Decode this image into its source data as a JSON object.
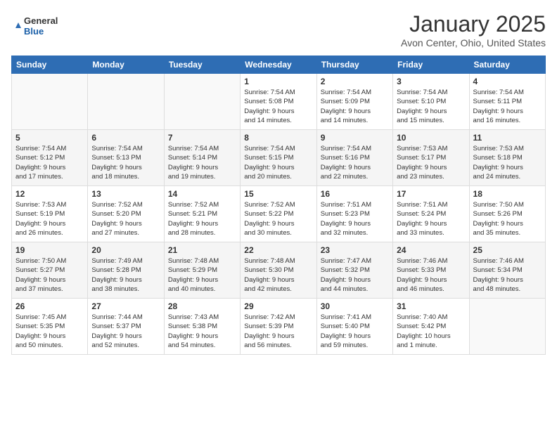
{
  "header": {
    "logo_general": "General",
    "logo_blue": "Blue",
    "month": "January 2025",
    "location": "Avon Center, Ohio, United States"
  },
  "weekdays": [
    "Sunday",
    "Monday",
    "Tuesday",
    "Wednesday",
    "Thursday",
    "Friday",
    "Saturday"
  ],
  "weeks": [
    [
      {
        "day": "",
        "info": ""
      },
      {
        "day": "",
        "info": ""
      },
      {
        "day": "",
        "info": ""
      },
      {
        "day": "1",
        "info": "Sunrise: 7:54 AM\nSunset: 5:08 PM\nDaylight: 9 hours\nand 14 minutes."
      },
      {
        "day": "2",
        "info": "Sunrise: 7:54 AM\nSunset: 5:09 PM\nDaylight: 9 hours\nand 14 minutes."
      },
      {
        "day": "3",
        "info": "Sunrise: 7:54 AM\nSunset: 5:10 PM\nDaylight: 9 hours\nand 15 minutes."
      },
      {
        "day": "4",
        "info": "Sunrise: 7:54 AM\nSunset: 5:11 PM\nDaylight: 9 hours\nand 16 minutes."
      }
    ],
    [
      {
        "day": "5",
        "info": "Sunrise: 7:54 AM\nSunset: 5:12 PM\nDaylight: 9 hours\nand 17 minutes."
      },
      {
        "day": "6",
        "info": "Sunrise: 7:54 AM\nSunset: 5:13 PM\nDaylight: 9 hours\nand 18 minutes."
      },
      {
        "day": "7",
        "info": "Sunrise: 7:54 AM\nSunset: 5:14 PM\nDaylight: 9 hours\nand 19 minutes."
      },
      {
        "day": "8",
        "info": "Sunrise: 7:54 AM\nSunset: 5:15 PM\nDaylight: 9 hours\nand 20 minutes."
      },
      {
        "day": "9",
        "info": "Sunrise: 7:54 AM\nSunset: 5:16 PM\nDaylight: 9 hours\nand 22 minutes."
      },
      {
        "day": "10",
        "info": "Sunrise: 7:53 AM\nSunset: 5:17 PM\nDaylight: 9 hours\nand 23 minutes."
      },
      {
        "day": "11",
        "info": "Sunrise: 7:53 AM\nSunset: 5:18 PM\nDaylight: 9 hours\nand 24 minutes."
      }
    ],
    [
      {
        "day": "12",
        "info": "Sunrise: 7:53 AM\nSunset: 5:19 PM\nDaylight: 9 hours\nand 26 minutes."
      },
      {
        "day": "13",
        "info": "Sunrise: 7:52 AM\nSunset: 5:20 PM\nDaylight: 9 hours\nand 27 minutes."
      },
      {
        "day": "14",
        "info": "Sunrise: 7:52 AM\nSunset: 5:21 PM\nDaylight: 9 hours\nand 28 minutes."
      },
      {
        "day": "15",
        "info": "Sunrise: 7:52 AM\nSunset: 5:22 PM\nDaylight: 9 hours\nand 30 minutes."
      },
      {
        "day": "16",
        "info": "Sunrise: 7:51 AM\nSunset: 5:23 PM\nDaylight: 9 hours\nand 32 minutes."
      },
      {
        "day": "17",
        "info": "Sunrise: 7:51 AM\nSunset: 5:24 PM\nDaylight: 9 hours\nand 33 minutes."
      },
      {
        "day": "18",
        "info": "Sunrise: 7:50 AM\nSunset: 5:26 PM\nDaylight: 9 hours\nand 35 minutes."
      }
    ],
    [
      {
        "day": "19",
        "info": "Sunrise: 7:50 AM\nSunset: 5:27 PM\nDaylight: 9 hours\nand 37 minutes."
      },
      {
        "day": "20",
        "info": "Sunrise: 7:49 AM\nSunset: 5:28 PM\nDaylight: 9 hours\nand 38 minutes."
      },
      {
        "day": "21",
        "info": "Sunrise: 7:48 AM\nSunset: 5:29 PM\nDaylight: 9 hours\nand 40 minutes."
      },
      {
        "day": "22",
        "info": "Sunrise: 7:48 AM\nSunset: 5:30 PM\nDaylight: 9 hours\nand 42 minutes."
      },
      {
        "day": "23",
        "info": "Sunrise: 7:47 AM\nSunset: 5:32 PM\nDaylight: 9 hours\nand 44 minutes."
      },
      {
        "day": "24",
        "info": "Sunrise: 7:46 AM\nSunset: 5:33 PM\nDaylight: 9 hours\nand 46 minutes."
      },
      {
        "day": "25",
        "info": "Sunrise: 7:46 AM\nSunset: 5:34 PM\nDaylight: 9 hours\nand 48 minutes."
      }
    ],
    [
      {
        "day": "26",
        "info": "Sunrise: 7:45 AM\nSunset: 5:35 PM\nDaylight: 9 hours\nand 50 minutes."
      },
      {
        "day": "27",
        "info": "Sunrise: 7:44 AM\nSunset: 5:37 PM\nDaylight: 9 hours\nand 52 minutes."
      },
      {
        "day": "28",
        "info": "Sunrise: 7:43 AM\nSunset: 5:38 PM\nDaylight: 9 hours\nand 54 minutes."
      },
      {
        "day": "29",
        "info": "Sunrise: 7:42 AM\nSunset: 5:39 PM\nDaylight: 9 hours\nand 56 minutes."
      },
      {
        "day": "30",
        "info": "Sunrise: 7:41 AM\nSunset: 5:40 PM\nDaylight: 9 hours\nand 59 minutes."
      },
      {
        "day": "31",
        "info": "Sunrise: 7:40 AM\nSunset: 5:42 PM\nDaylight: 10 hours\nand 1 minute."
      },
      {
        "day": "",
        "info": ""
      }
    ]
  ]
}
